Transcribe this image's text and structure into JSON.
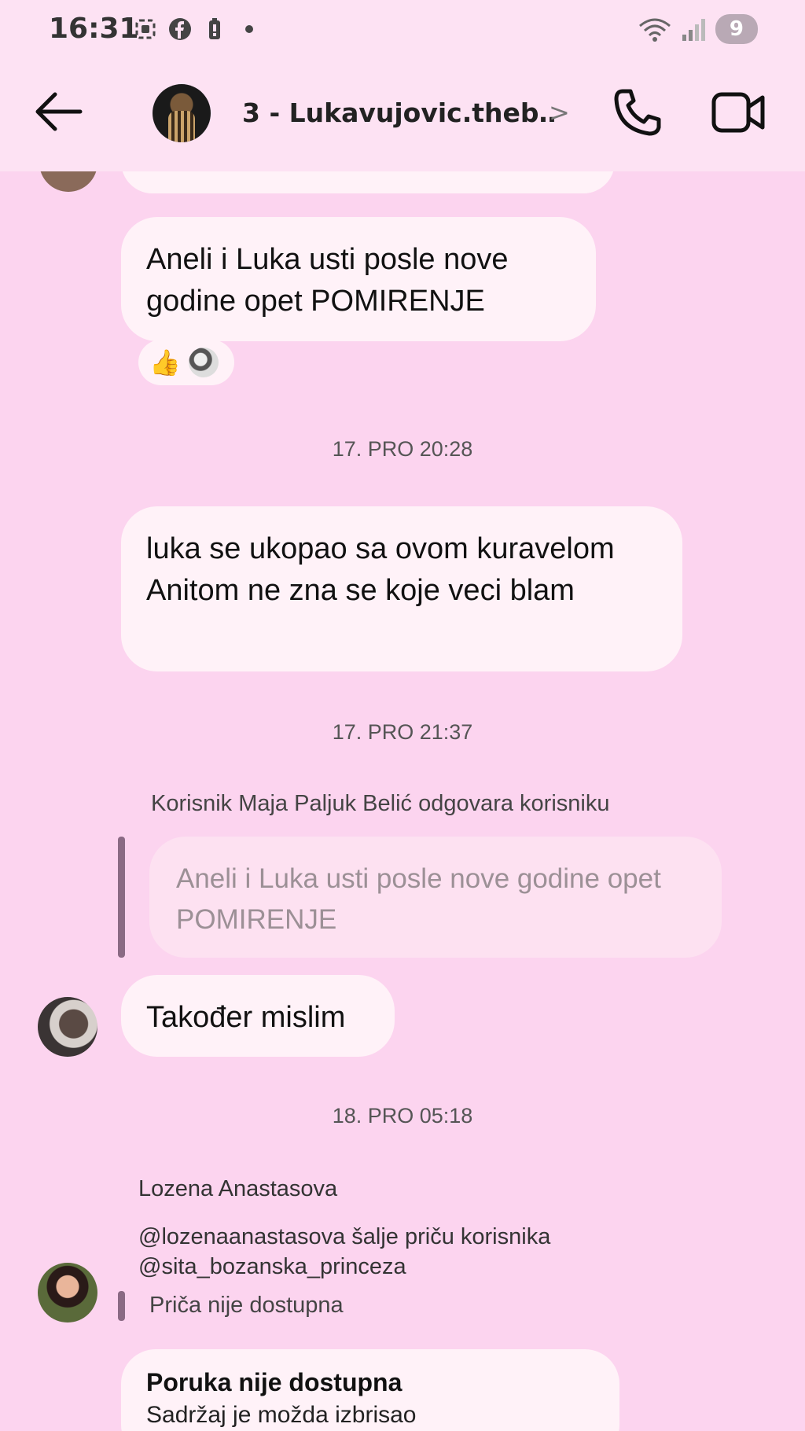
{
  "status_bar": {
    "time": "16:31",
    "battery": "9"
  },
  "header": {
    "title": "3 - Lukavujovic.theb…",
    "chevron": ">"
  },
  "messages": {
    "msg1": "Aneli i Luka usti posle nove godine opet POMIRENJE",
    "reaction_emoji": "👍",
    "ts1": "17. PRO 20:28",
    "msg2": "luka se ukopao sa ovom kuravelom Anitom ne zna se koje veci blam",
    "ts2": "17. PRO 21:37",
    "reply_label": "Korisnik Maja Paljuk Belić odgovara korisniku",
    "quoted_text": "Aneli i Luka usti posle nove godine opet POMIRENJE",
    "msg3": "Također mislim",
    "ts3": "18. PRO 05:18",
    "share_sender": "Lozena Anastasova",
    "share_line1": "@lozenaanastasova šalje priču korisnika",
    "share_line2": "@sita_bozanska_princeza",
    "story_status": "Priča nije dostupna",
    "unavailable_title": "Poruka nije dostupna",
    "unavailable_sub": "Sadržaj je možda izbrisao"
  },
  "colors": {
    "background": "#fcd4ef",
    "header_bg": "#fde2f3",
    "bubble": "#fff2f8",
    "reply_bar": "#8a6a84"
  }
}
